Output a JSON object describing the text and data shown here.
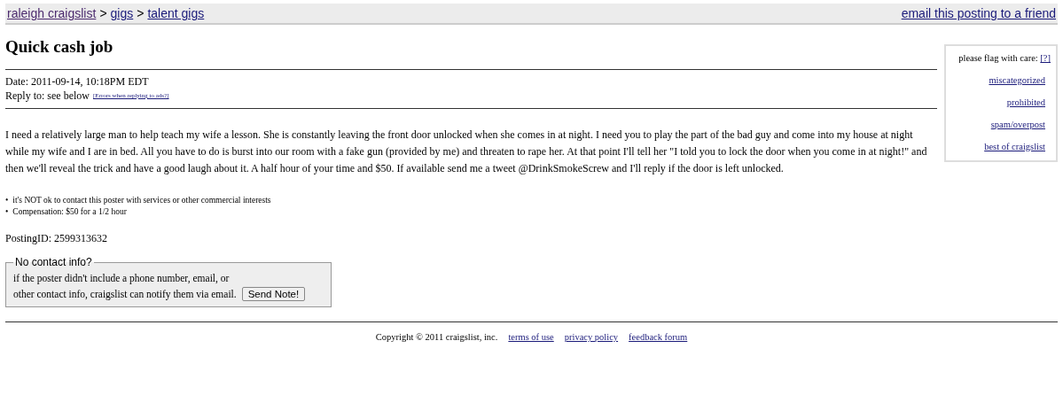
{
  "breadcrumb": [
    {
      "label": "raleigh craigslist"
    },
    {
      "label": "gigs"
    },
    {
      "label": "talent gigs"
    }
  ],
  "breadcrumb_separator": ">",
  "email_link": "email this posting to a friend",
  "title": "Quick cash job",
  "date": "Date: 2011-09-14, 10:18PM EDT",
  "reply_to": "Reply to: see below",
  "reply_help_link": "[Errors when replying to ads?]",
  "body": "I need a relatively large man to help teach my wife a lesson. She is constantly leaving the front door unlocked when she comes in at night. I need you to play the part of the bad guy and come into my house at night while my wife and I are in bed. All you have to do is burst into our room with a fake gun (provided by me) and threaten to rape her. At that point I'll tell her \"I told you to lock the door when you come in at night!\" and then we'll reveal the trick and have a good laugh about it. A half hour of your time and $50. If available send me a tweet @DrinkSmokeScrew and I'll reply if the door is left unlocked.",
  "note_bullet": "•",
  "notes": [
    "it's NOT ok to contact this poster with services or other commercial interests",
    "Compensation: $50 for a 1/2 hour"
  ],
  "posting_id": "PostingID: 2599313632",
  "contact_box": {
    "legend": "No contact info?",
    "line_1": "if the poster didn't include a phone number, email, or",
    "line_2": "other contact info, craigslist can notify them via email.",
    "button": "Send Note!"
  },
  "flag_box": {
    "heading": "please flag with care:",
    "help_link": "[?]",
    "links": [
      "miscategorized",
      "prohibited",
      "spam/overpost",
      "best of craigslist"
    ]
  },
  "footer": {
    "copyright": "Copyright © 2011 craigslist, inc.",
    "links": [
      "terms of use",
      "privacy policy",
      "feedback forum"
    ]
  }
}
